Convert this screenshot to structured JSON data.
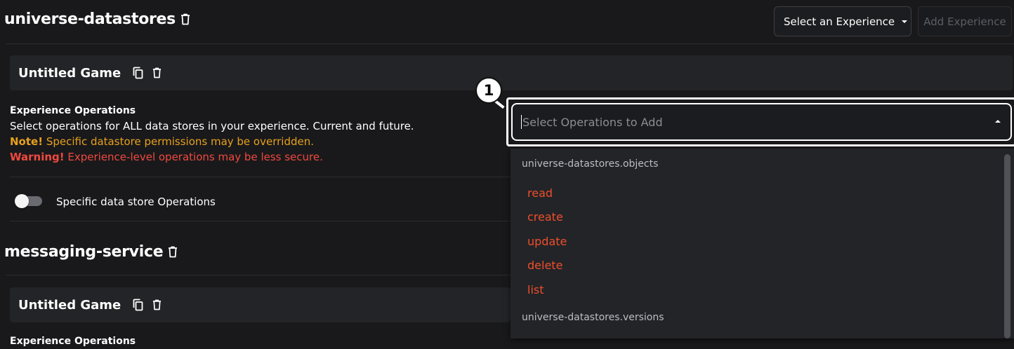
{
  "header": {
    "select_experience_label": "Select an Experience",
    "add_experience_label": "Add Experience"
  },
  "sections": [
    {
      "title": "universe-datastores",
      "card": {
        "title": "Untitled Game",
        "ops_heading": "Experience Operations",
        "ops_desc": "Select operations for ALL data stores in your experience. Current and future.",
        "note_label": "Note!",
        "note_text": " Specific datastore permissions may be overridden.",
        "warning_label": "Warning!",
        "warning_text": " Experience-level operations may be less secure.",
        "toggle_label": "Specific data store Operations"
      }
    },
    {
      "title": "messaging-service",
      "card": {
        "title": "Untitled Game",
        "ops_heading": "Experience Operations"
      }
    }
  ],
  "operations_select": {
    "placeholder": "Select Operations to Add",
    "badge": "1",
    "groups": [
      {
        "label": "universe-datastores.objects",
        "options": [
          "read",
          "create",
          "update",
          "delete",
          "list"
        ]
      },
      {
        "label": "universe-datastores.versions",
        "options": []
      }
    ]
  },
  "colors": {
    "background": "#19191b",
    "card": "#232427",
    "note": "#e6a11d",
    "warning": "#f0493e",
    "option": "#ef4e2a"
  },
  "icons": [
    "trash-icon",
    "copy-icon",
    "chevron-down-icon",
    "chevron-up-icon"
  ]
}
